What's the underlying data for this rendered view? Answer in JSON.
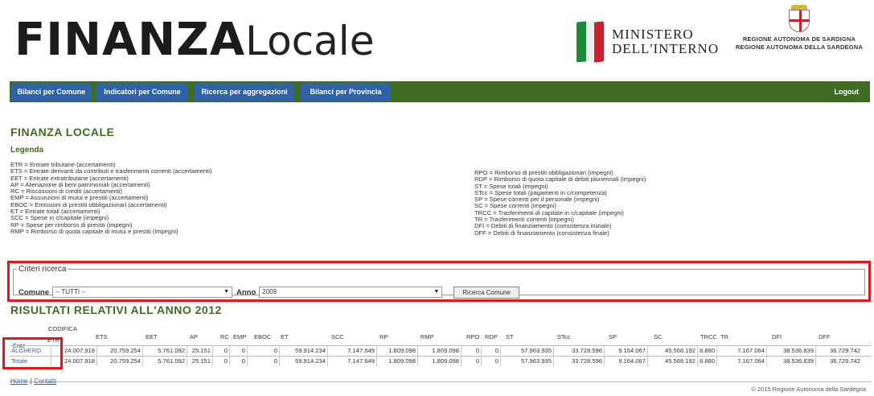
{
  "header": {
    "logo_bold": "FINANZA",
    "logo_light": "Locale",
    "ministero_line1": "MINISTERO",
    "ministero_line2": "DELL'INTERNO",
    "regione_line1": "REGIONE AUTONOMA DE SARDIGNA",
    "regione_line2": "REGIONE AUTONOMA DELLA SARDEGNA"
  },
  "nav": {
    "items": [
      "Bilanci per Comune",
      "Indicatori per Comune",
      "Ricerca per aggregazioni",
      "Bilanci per Provincia"
    ],
    "logout": "Logout"
  },
  "page_title": "FINANZA LOCALE",
  "legend_title": "Legenda",
  "legend_left": [
    "ETR = Entrate tributarie (accertamenti)",
    "ETS = Entrate derivanti da contributi e trasferimenti correnti (accertamenti)",
    "EET = Entrate extratributarie (accertamenti)",
    "AP = Alienazione di beni patrimoniali (accertamenti)",
    "RC = Riscossioni di crediti (accertamenti)",
    "EMP = Assunzioni di mutui e prestiti (accertamenti)",
    "EBOC = Emissioni di prestiti obbligazionari (accertamenti)",
    "ET = Entrate totali (accertamenti)",
    "SCC = Spese in c/capitale (impegni)",
    "RP = Spese per rimborso di prestiti (impegni)",
    "RMP = Rimborso di quota capitale di mutui e prestiti (impegni)"
  ],
  "legend_right": [
    "RPO = Rimborso di prestiti obbligazionari (impegni)",
    "RDP = Rimborso di quota capitale di debiti pluriennali (impegni)",
    "ST = Spese totali (impegni)",
    "STcc = Spese totali (pagamenti in c/competenza)",
    "SP = Spese correnti per il personale (impegni)",
    "SC = Spese correnti (impegni)",
    "TRCC = Trasferimenti di capitale in c/capitale (impegni)",
    "TR = Trasferimenti correnti (impegni)",
    "DFI = Debiti di finanziamento (consistenza iniziale)",
    "DFF = Debiti di finanziamento (consistenza finale)"
  ],
  "criteri": {
    "legend": "Criteri ricerca",
    "comune_label": "Comune",
    "comune_value": "-- TUTTI --",
    "anno_label": "Anno",
    "anno_value": "2009",
    "search_button": "Ricerca Comune"
  },
  "results_title": "RISULTATI RELATIVI ALL'ANNO 2012",
  "table": {
    "codifica": "CODIFICA",
    "ente_header": "Ente",
    "columns": [
      "ETR",
      "ETS",
      "EET",
      "AP",
      "RC",
      "EMP",
      "EBOC",
      "ET",
      "SCC",
      "RP",
      "RMP",
      "RPO",
      "RDP",
      "ST",
      "STcc",
      "SP",
      "SC",
      "TRCC",
      "TR",
      "DFI",
      "DFF"
    ],
    "rows": [
      {
        "name": "ALGHERO",
        "values": [
          "24.007.918",
          "20.759.254",
          "5.761.092",
          "25.151",
          "0",
          "0",
          "0",
          "59.914.234",
          "7.147.649",
          "1.809.098",
          "1.809.098",
          "0",
          "0",
          "57.963.935",
          "33.728.596",
          "9.164.067",
          "45.566.192",
          "8.880",
          "7.167.064",
          "38.536.839",
          "36.729.742"
        ]
      },
      {
        "name": "Totale",
        "values": [
          "24.007.918",
          "20.759.254",
          "5.761.092",
          "25.151",
          "0",
          "0",
          "0",
          "59.914.234",
          "7.147.649",
          "1.809.098",
          "1.809.098",
          "0",
          "0",
          "57.963.935",
          "33.728.596",
          "9.164.067",
          "45.566.192",
          "8.880",
          "7.167.064",
          "38.536.839",
          "36.729.742"
        ]
      }
    ]
  },
  "footer": {
    "home": "Home",
    "separator": "|",
    "contatti": "Contatti",
    "copyright": "© 2015 Regione Autonoma della Sardegna"
  },
  "colors": {
    "brand_green": "#3f6b23",
    "nav_blue": "#2f62a8",
    "highlight_red": "#e2161b"
  }
}
